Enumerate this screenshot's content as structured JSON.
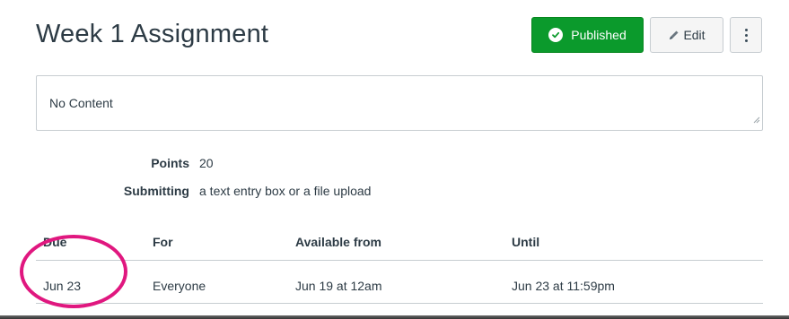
{
  "page": {
    "title": "Week 1 Assignment"
  },
  "header_actions": {
    "published_label": "Published",
    "edit_label": "Edit",
    "more_icon": "vertical-ellipsis-icon",
    "published_color": "#0b9a2c"
  },
  "description": {
    "text": "No Content"
  },
  "details": [
    {
      "label": "Points",
      "value": "20"
    },
    {
      "label": "Submitting",
      "value": "a text entry box or a file upload"
    }
  ],
  "dates_table": {
    "columns": [
      "Due",
      "For",
      "Available from",
      "Until"
    ],
    "rows": [
      [
        "Jun 23",
        "Everyone",
        "Jun 19 at 12am",
        "Jun 23 at 11:59pm"
      ]
    ]
  },
  "annotation": {
    "highlight_color": "#e0177f"
  }
}
